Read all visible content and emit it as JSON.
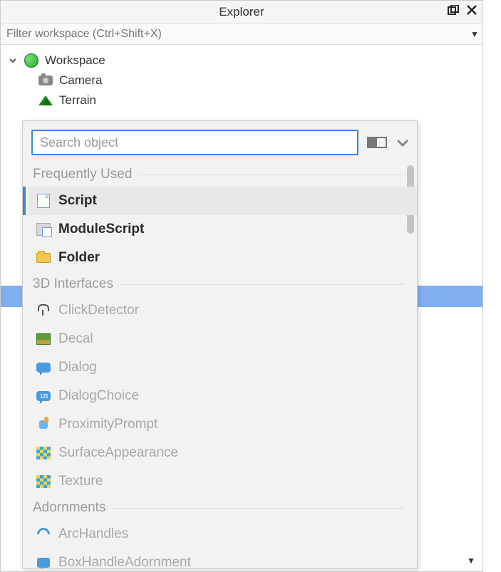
{
  "panel": {
    "title": "Explorer",
    "filter_placeholder": "Filter workspace (Ctrl+Shift+X)"
  },
  "tree": {
    "root": "Workspace",
    "children": [
      "Camera",
      "Terrain"
    ]
  },
  "popup": {
    "search_placeholder": "Search object",
    "sections": {
      "freq": "Frequently Used",
      "interfaces": "3D Interfaces",
      "adorn": "Adornments"
    },
    "frequent": [
      "Script",
      "ModuleScript",
      "Folder"
    ],
    "interfaces": [
      "ClickDetector",
      "Decal",
      "Dialog",
      "DialogChoice",
      "ProximityPrompt",
      "SurfaceAppearance",
      "Texture"
    ],
    "adorn": [
      "ArcHandles",
      "BoxHandleAdornment"
    ],
    "dchoice_glyph": "123"
  }
}
